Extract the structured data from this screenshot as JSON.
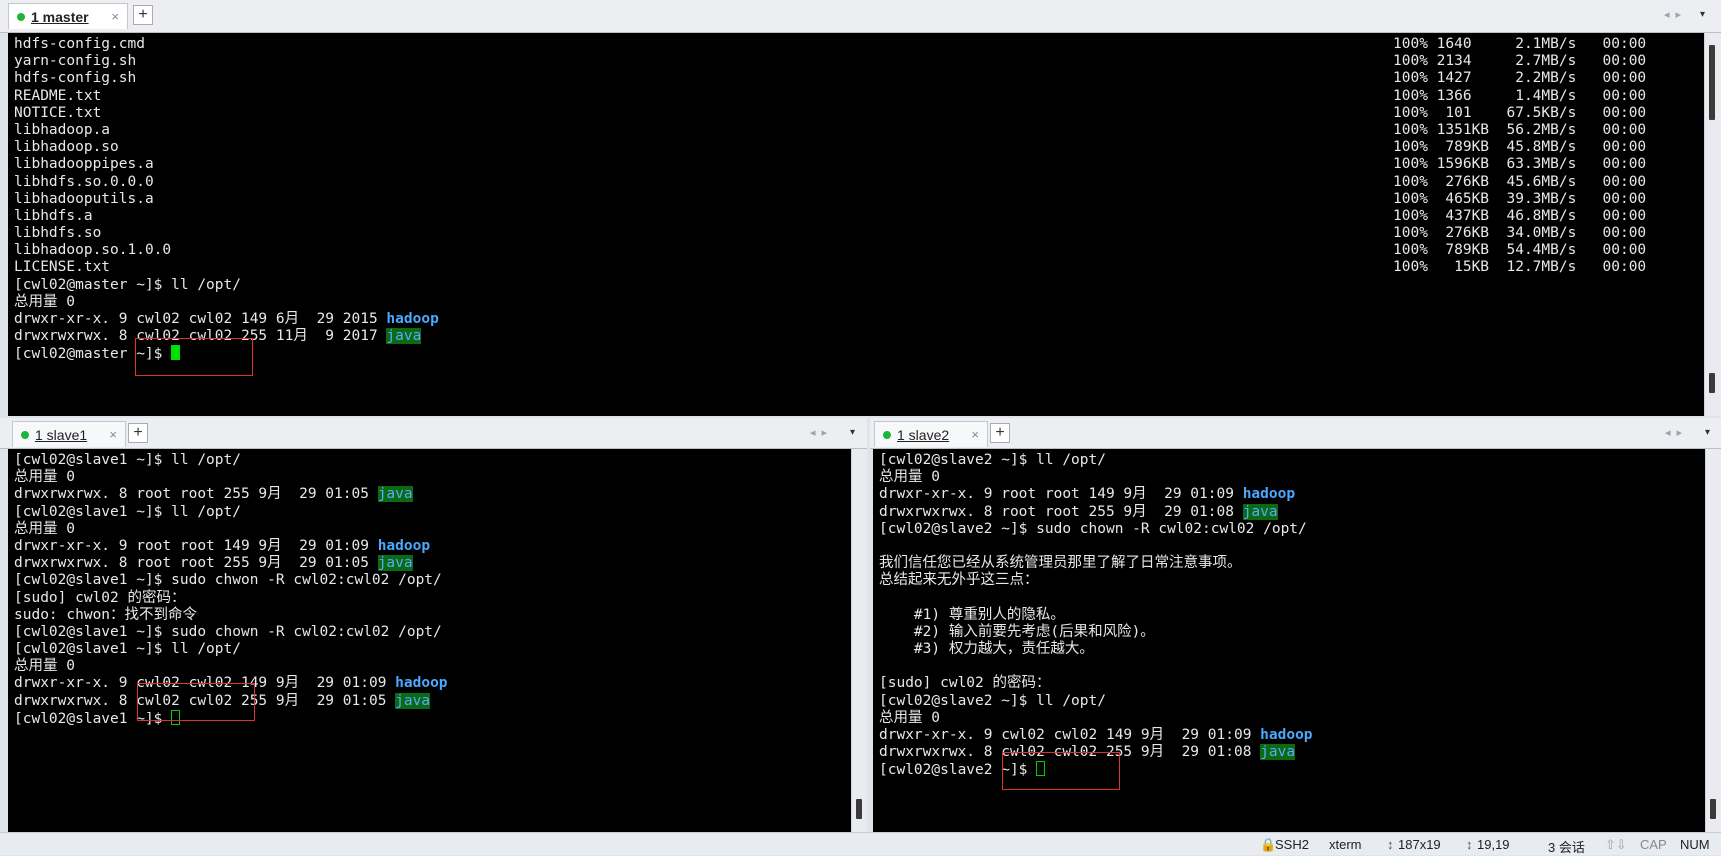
{
  "master": {
    "tab_label": "1 master",
    "close_glyph": "×",
    "add_tab": "+",
    "lines": [
      [
        {
          "t": "hdfs-config.cmd"
        }
      ],
      [
        {
          "t": "yarn-config.sh"
        }
      ],
      [
        {
          "t": "hdfs-config.sh"
        }
      ],
      [
        {
          "t": "README.txt"
        }
      ],
      [
        {
          "t": "NOTICE.txt"
        }
      ],
      [
        {
          "t": "libhadoop.a"
        }
      ],
      [
        {
          "t": "libhadoop.so"
        }
      ],
      [
        {
          "t": "libhadooppipes.a"
        }
      ],
      [
        {
          "t": "libhdfs.so.0.0.0"
        }
      ],
      [
        {
          "t": "libhadooputils.a"
        }
      ],
      [
        {
          "t": "libhdfs.a"
        }
      ],
      [
        {
          "t": "libhdfs.so"
        }
      ],
      [
        {
          "t": "libhadoop.so.1.0.0"
        }
      ],
      [
        {
          "t": "LICENSE.txt"
        }
      ],
      [
        {
          "t": "[cwl02@master ~]$ ll /opt/"
        }
      ],
      [
        {
          "t": "总用量 0"
        }
      ],
      [
        {
          "t": "drwxr-xr-x. 9 cwl02 cwl02 149 6月  29 2015 "
        },
        {
          "t": "hadoop",
          "c": "hd"
        }
      ],
      [
        {
          "t": "drwxrwxrwx. 8 cwl02 cwl02 255 11月  9 2017 "
        },
        {
          "t": "java",
          "c": "jv"
        }
      ],
      [
        {
          "t": "[cwl02@master ~]$ "
        },
        {
          "cursor": "fill"
        }
      ]
    ],
    "transfers": [
      "100% 1640     2.1MB/s   00:00",
      "100% 2134     2.7MB/s   00:00",
      "100% 1427     2.2MB/s   00:00",
      "100% 1366     1.4MB/s   00:00",
      "100%  101    67.5KB/s   00:00",
      "100% 1351KB  56.2MB/s   00:00",
      "100%  789KB  45.8MB/s   00:00",
      "100% 1596KB  63.3MB/s   00:00",
      "100%  276KB  45.6MB/s   00:00",
      "100%  465KB  39.3MB/s   00:00",
      "100%  437KB  46.8MB/s   00:00",
      "100%  276KB  34.0MB/s   00:00",
      "100%  789KB  54.4MB/s   00:00",
      "100%   15KB  12.7MB/s   00:00"
    ]
  },
  "slave1": {
    "tab_label": "1 slave1",
    "close_glyph": "×",
    "add_tab": "+",
    "lines": [
      [
        {
          "t": "[cwl02@slave1 ~]$ ll /opt/"
        }
      ],
      [
        {
          "t": "总用量 0"
        }
      ],
      [
        {
          "t": "drwxrwxrwx. 8 root root 255 9月  29 01:05 "
        },
        {
          "t": "java",
          "c": "jv"
        }
      ],
      [
        {
          "t": "[cwl02@slave1 ~]$ ll /opt/"
        }
      ],
      [
        {
          "t": "总用量 0"
        }
      ],
      [
        {
          "t": "drwxr-xr-x. 9 root root 149 9月  29 01:09 "
        },
        {
          "t": "hadoop",
          "c": "hd"
        }
      ],
      [
        {
          "t": "drwxrwxrwx. 8 root root 255 9月  29 01:05 "
        },
        {
          "t": "java",
          "c": "jv"
        }
      ],
      [
        {
          "t": "[cwl02@slave1 ~]$ sudo chwon -R cwl02:cwl02 /opt/"
        }
      ],
      [
        {
          "t": "[sudo] cwl02 的密码："
        }
      ],
      [
        {
          "t": "sudo: chwon：找不到命令"
        }
      ],
      [
        {
          "t": "[cwl02@slave1 ~]$ sudo chown -R cwl02:cwl02 /opt/"
        }
      ],
      [
        {
          "t": "[cwl02@slave1 ~]$ ll /opt/"
        }
      ],
      [
        {
          "t": "总用量 0"
        }
      ],
      [
        {
          "t": "drwxr-xr-x. 9 cwl02 cwl02 149 9月  29 01:09 "
        },
        {
          "t": "hadoop",
          "c": "hd"
        }
      ],
      [
        {
          "t": "drwxrwxrwx. 8 cwl02 cwl02 255 9月  29 01:05 "
        },
        {
          "t": "java",
          "c": "jv"
        }
      ],
      [
        {
          "t": "[cwl02@slave1 ~]$ "
        },
        {
          "cursor": "hollow"
        }
      ]
    ]
  },
  "slave2": {
    "tab_label": "1 slave2",
    "close_glyph": "×",
    "add_tab": "+",
    "lines": [
      [
        {
          "t": "[cwl02@slave2 ~]$ ll /opt/"
        }
      ],
      [
        {
          "t": "总用量 0"
        }
      ],
      [
        {
          "t": "drwxr-xr-x. 9 root root 149 9月  29 01:09 "
        },
        {
          "t": "hadoop",
          "c": "hd"
        }
      ],
      [
        {
          "t": "drwxrwxrwx. 8 root root 255 9月  29 01:08 "
        },
        {
          "t": "java",
          "c": "jv"
        }
      ],
      [
        {
          "t": "[cwl02@slave2 ~]$ sudo chown -R cwl02:cwl02 /opt/"
        }
      ],
      [
        {
          "t": ""
        }
      ],
      [
        {
          "t": "我们信任您已经从系统管理员那里了解了日常注意事项。"
        }
      ],
      [
        {
          "t": "总结起来无外乎这三点："
        }
      ],
      [
        {
          "t": ""
        }
      ],
      [
        {
          "t": "    #1) 尊重别人的隐私。"
        }
      ],
      [
        {
          "t": "    #2) 输入前要先考虑(后果和风险)。"
        }
      ],
      [
        {
          "t": "    #3) 权力越大，责任越大。"
        }
      ],
      [
        {
          "t": ""
        }
      ],
      [
        {
          "t": "[sudo] cwl02 的密码："
        }
      ],
      [
        {
          "t": "[cwl02@slave2 ~]$ ll /opt/"
        }
      ],
      [
        {
          "t": "总用量 0"
        }
      ],
      [
        {
          "t": "drwxr-xr-x. 9 cwl02 cwl02 149 9月  29 01:09 "
        },
        {
          "t": "hadoop",
          "c": "hd"
        }
      ],
      [
        {
          "t": "drwxrwxrwx. 8 cwl02 cwl02 255 9月  29 01:08 "
        },
        {
          "t": "java",
          "c": "jv"
        }
      ],
      [
        {
          "t": "[cwl02@slave2 ~]$ "
        },
        {
          "cursor": "hollow"
        }
      ]
    ]
  },
  "status": {
    "protocol": "SSH2",
    "term_type": "xterm",
    "size": "187x19",
    "cursor_pos": "19,19",
    "sessions": "3 会话",
    "caps": "CAP",
    "num": "NUM"
  },
  "colors": {
    "terminal_bg": "#000000",
    "text": "#e8e8e8",
    "dir": "#4aa8ff",
    "java_bg": "#0a6b14",
    "highlight_box": "#e03030",
    "cursor": "#00e000"
  }
}
